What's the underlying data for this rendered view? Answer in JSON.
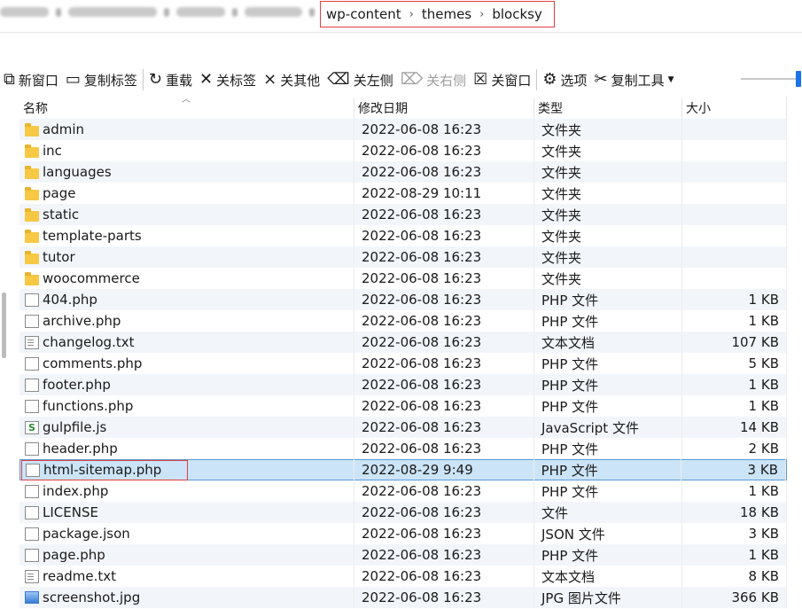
{
  "address_bar": {
    "breadcrumbs": [
      "wp-content",
      "themes",
      "blocksy"
    ]
  },
  "toolbar": {
    "items": [
      {
        "label": "新窗口",
        "icon": "new-window-icon",
        "enabled": true
      },
      {
        "label": "复制标签",
        "icon": "duplicate-tab-icon",
        "enabled": true
      },
      {
        "label": "重载",
        "icon": "reload-icon",
        "enabled": true
      },
      {
        "label": "关标签",
        "icon": "close-tab-icon",
        "enabled": true
      },
      {
        "label": "关其他",
        "icon": "close-others-icon",
        "enabled": true
      },
      {
        "label": "关左侧",
        "icon": "close-left-icon",
        "enabled": true
      },
      {
        "label": "关右侧",
        "icon": "close-right-icon",
        "enabled": false
      },
      {
        "label": "关窗口",
        "icon": "close-window-icon",
        "enabled": true
      },
      {
        "label": "选项",
        "icon": "gear-icon",
        "enabled": true
      },
      {
        "label": "复制工具",
        "icon": "scissors-icon",
        "enabled": true
      }
    ]
  },
  "columns": [
    "名称",
    "修改日期",
    "类型",
    "大小"
  ],
  "files": [
    {
      "name": "admin",
      "date": "2022-06-08 16:23",
      "type": "文件夹",
      "size": "",
      "icon": "folder"
    },
    {
      "name": "inc",
      "date": "2022-06-08 16:23",
      "type": "文件夹",
      "size": "",
      "icon": "folder"
    },
    {
      "name": "languages",
      "date": "2022-06-08 16:23",
      "type": "文件夹",
      "size": "",
      "icon": "folder"
    },
    {
      "name": "page",
      "date": "2022-08-29 10:11",
      "type": "文件夹",
      "size": "",
      "icon": "folder"
    },
    {
      "name": "static",
      "date": "2022-06-08 16:23",
      "type": "文件夹",
      "size": "",
      "icon": "folder"
    },
    {
      "name": "template-parts",
      "date": "2022-06-08 16:23",
      "type": "文件夹",
      "size": "",
      "icon": "folder"
    },
    {
      "name": "tutor",
      "date": "2022-06-08 16:23",
      "type": "文件夹",
      "size": "",
      "icon": "folder"
    },
    {
      "name": "woocommerce",
      "date": "2022-06-08 16:23",
      "type": "文件夹",
      "size": "",
      "icon": "folder"
    },
    {
      "name": "404.php",
      "date": "2022-06-08 16:23",
      "type": "PHP 文件",
      "size": "1 KB",
      "icon": "doc"
    },
    {
      "name": "archive.php",
      "date": "2022-06-08 16:23",
      "type": "PHP 文件",
      "size": "1 KB",
      "icon": "doc"
    },
    {
      "name": "changelog.txt",
      "date": "2022-06-08 16:23",
      "type": "文本文档",
      "size": "107 KB",
      "icon": "txt"
    },
    {
      "name": "comments.php",
      "date": "2022-06-08 16:23",
      "type": "PHP 文件",
      "size": "5 KB",
      "icon": "doc"
    },
    {
      "name": "footer.php",
      "date": "2022-06-08 16:23",
      "type": "PHP 文件",
      "size": "1 KB",
      "icon": "doc"
    },
    {
      "name": "functions.php",
      "date": "2022-06-08 16:23",
      "type": "PHP 文件",
      "size": "1 KB",
      "icon": "doc"
    },
    {
      "name": "gulpfile.js",
      "date": "2022-06-08 16:23",
      "type": "JavaScript 文件",
      "size": "14 KB",
      "icon": "js"
    },
    {
      "name": "header.php",
      "date": "2022-06-08 16:23",
      "type": "PHP 文件",
      "size": "2 KB",
      "icon": "doc"
    },
    {
      "name": "html-sitemap.php",
      "date": "2022-08-29 9:49",
      "type": "PHP 文件",
      "size": "3 KB",
      "icon": "doc",
      "selected": true
    },
    {
      "name": "index.php",
      "date": "2022-06-08 16:23",
      "type": "PHP 文件",
      "size": "1 KB",
      "icon": "doc"
    },
    {
      "name": "LICENSE",
      "date": "2022-06-08 16:23",
      "type": "文件",
      "size": "18 KB",
      "icon": "doc"
    },
    {
      "name": "package.json",
      "date": "2022-06-08 16:23",
      "type": "JSON 文件",
      "size": "3 KB",
      "icon": "doc"
    },
    {
      "name": "page.php",
      "date": "2022-06-08 16:23",
      "type": "PHP 文件",
      "size": "1 KB",
      "icon": "doc"
    },
    {
      "name": "readme.txt",
      "date": "2022-06-08 16:23",
      "type": "文本文档",
      "size": "8 KB",
      "icon": "txt"
    },
    {
      "name": "screenshot.jpg",
      "date": "2022-06-08 16:23",
      "type": "JPG 图片文件",
      "size": "366 KB",
      "icon": "img"
    }
  ],
  "colors": {
    "selection_bg": "#cce4f7",
    "highlight_border": "#e04040",
    "folder": "#f7c843"
  }
}
